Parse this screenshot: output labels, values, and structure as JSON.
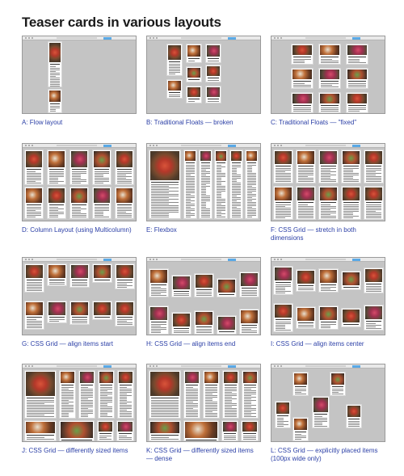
{
  "page": {
    "title": "Teaser cards in various layouts"
  },
  "tiles": [
    {
      "caption": "A: Flow layout"
    },
    {
      "caption": "B: Traditional Floats — broken"
    },
    {
      "caption": "C: Traditional Floats — \"fixed\""
    },
    {
      "caption": "D: Column Layout (using Multicolumn)"
    },
    {
      "caption": "E: Flexbox"
    },
    {
      "caption": "F: CSS Grid — stretch in both dimensions"
    },
    {
      "caption": "G: CSS Grid — align items start"
    },
    {
      "caption": "H: CSS Grid — align items end"
    },
    {
      "caption": "I: CSS Grid — align items center"
    },
    {
      "caption": "J: CSS Grid — differently sized items"
    },
    {
      "caption": "K: CSS Grid — differently sized items — dense"
    },
    {
      "caption": "L: CSS Grid — explicitly placed items (100px wide only)"
    }
  ],
  "colors": {
    "caption": "#2b3fa6",
    "viewport": "#c4c4c4",
    "card": "#ffffff",
    "browser_accent": "#5aa9e6"
  }
}
